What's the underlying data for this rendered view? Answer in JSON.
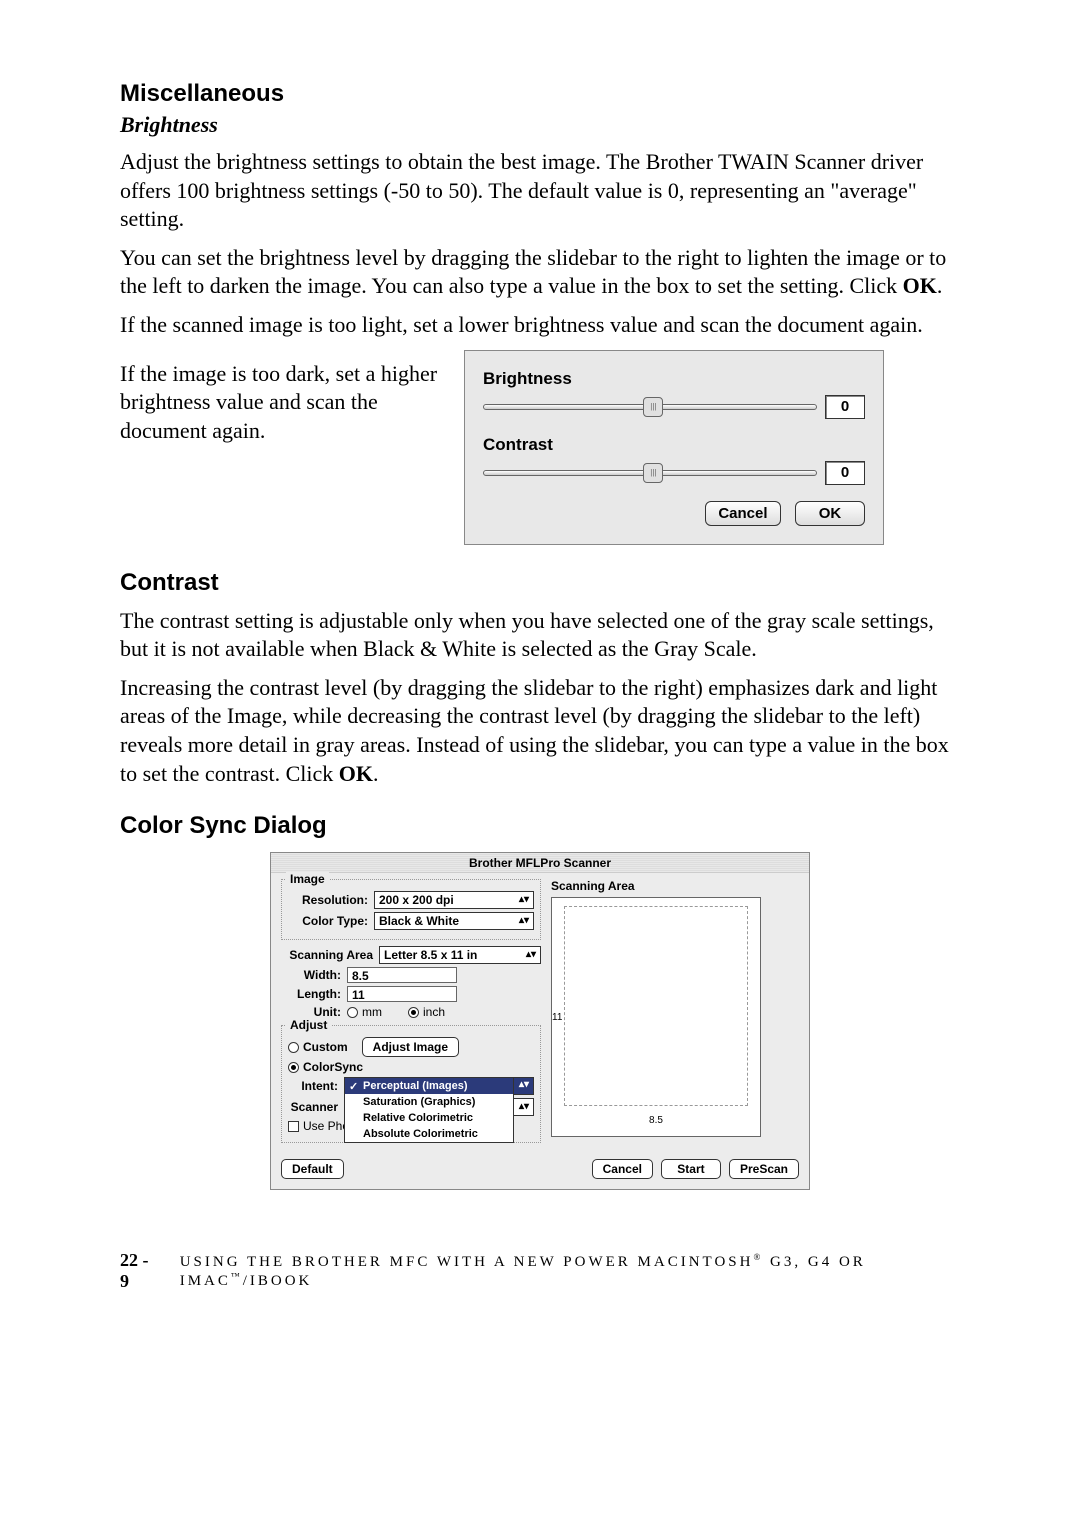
{
  "sections": {
    "misc_heading": "Miscellaneous",
    "brightness_sub": "Brightness",
    "brightness_p1": "Adjust the brightness settings to obtain the best image. The Brother TWAIN Scanner driver offers 100 brightness settings (-50 to 50). The default value is 0, representing an \"average\" setting.",
    "brightness_p2_a": "You can set the brightness level by dragging the slidebar to the right to lighten the image or to the left to darken the image. You can also type a value in the box to set the setting. Click ",
    "brightness_p2_b": "OK",
    "brightness_p2_c": ".",
    "brightness_p3": "If the scanned image is too light, set a lower brightness value and scan the document again.",
    "brightness_p4": "If the image is too dark, set a higher brightness value and scan the document again.",
    "contrast_heading": "Contrast",
    "contrast_p1": "The contrast setting is adjustable only when you have selected one of the gray scale settings, but it is not available when Black & White is selected as the Gray Scale.",
    "contrast_p2_a": "Increasing the contrast level (by dragging the slidebar to the right) emphasizes dark and light areas of the Image, while decreasing the contrast level (by dragging the slidebar to the left) reveals more detail in gray areas. Instead of using the slidebar, you can type a value in the box to set the contrast. Click ",
    "contrast_p2_b": "OK",
    "contrast_p2_c": ".",
    "colorsync_heading": "Color Sync Dialog"
  },
  "bc_dialog": {
    "brightness_label": "Brightness",
    "brightness_value": "0",
    "contrast_label": "Contrast",
    "contrast_value": "0",
    "cancel": "Cancel",
    "ok": "OK"
  },
  "cs_dialog": {
    "title": "Brother MFLPro Scanner",
    "image_group": "Image",
    "resolution_label": "Resolution:",
    "resolution_value": "200 x 200 dpi",
    "colortype_label": "Color Type:",
    "colortype_value": "Black & White",
    "scanarea_label": "Scanning Area",
    "scanarea_value": "Letter 8.5 x 11 in",
    "width_label": "Width:",
    "width_value": "8.5",
    "length_label": "Length:",
    "length_value": "11",
    "unit_label": "Unit:",
    "unit_mm": "mm",
    "unit_inch": "inch",
    "adjust_group": "Adjust",
    "custom_label": "Custom",
    "adjust_image_btn": "Adjust Image",
    "colorsync_label": "ColorSync",
    "intent_label": "Intent:",
    "intent_options": [
      "Perceptual (Images)",
      "Saturation (Graphics)",
      "Relative Colorimetric",
      "Absolute Colorimetric"
    ],
    "intent_selected": "Perceptual (Images)",
    "scanner_label": "Scanner",
    "usepho_label": "Use Pho",
    "scanning_area_heading": "Scanning Area",
    "preview_y": "11",
    "preview_x": "8.5",
    "default_btn": "Default",
    "cancel_btn": "Cancel",
    "start_btn": "Start",
    "prescan_btn": "PreScan"
  },
  "footer": {
    "page": "22 - 9",
    "chapter_a": "USING THE BROTHER MFC WITH A NEW POWER MACINTOSH",
    "chapter_b": " G3, G4 OR IMAC",
    "chapter_c": "/IBOOK"
  }
}
